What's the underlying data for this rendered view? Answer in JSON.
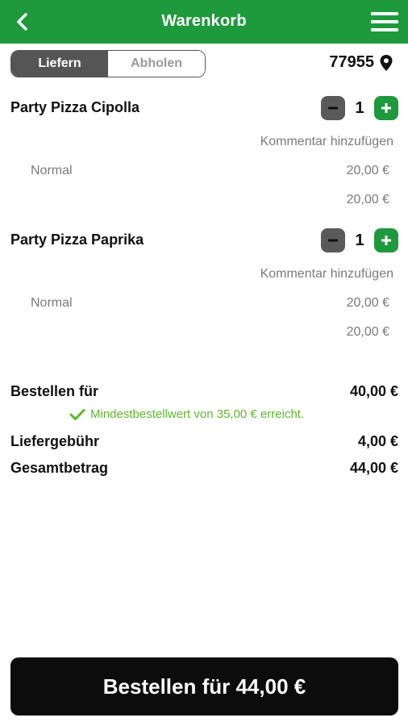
{
  "header": {
    "title": "Warenkorb",
    "back_icon": "chevron-left-icon",
    "menu_icon": "hamburger-menu-icon"
  },
  "mode_toggle": {
    "options": [
      "Liefern",
      "Abholen"
    ],
    "selected": "Liefern"
  },
  "location": {
    "zip": "77955",
    "icon": "map-pin-icon"
  },
  "items": [
    {
      "name": "Party Pizza Cipolla",
      "quantity": "1",
      "comment_link": "Kommentar hinzufügen",
      "variant": "Normal",
      "variant_price": "20,00 €",
      "line_total": "20,00 €"
    },
    {
      "name": "Party Pizza Paprika",
      "quantity": "1",
      "comment_link": "Kommentar hinzufügen",
      "variant": "Normal",
      "variant_price": "20,00 €",
      "line_total": "20,00 €"
    }
  ],
  "summary": {
    "order_for_label": "Bestellen für",
    "order_for_value": "40,00 €",
    "min_order_note": "Mindestbestellwert von 35,00 € erreicht.",
    "delivery_fee_label": "Liefergebühr",
    "delivery_fee_value": "4,00 €",
    "total_label": "Gesamtbetrag",
    "total_value": "44,00 €"
  },
  "order_button": {
    "label": "Bestellen für 44,00 €"
  },
  "colors": {
    "brand_green": "#1e9a3c",
    "note_green": "#5cb82a",
    "dark": "#0c0c0c",
    "muted": "#7a7a7a"
  }
}
